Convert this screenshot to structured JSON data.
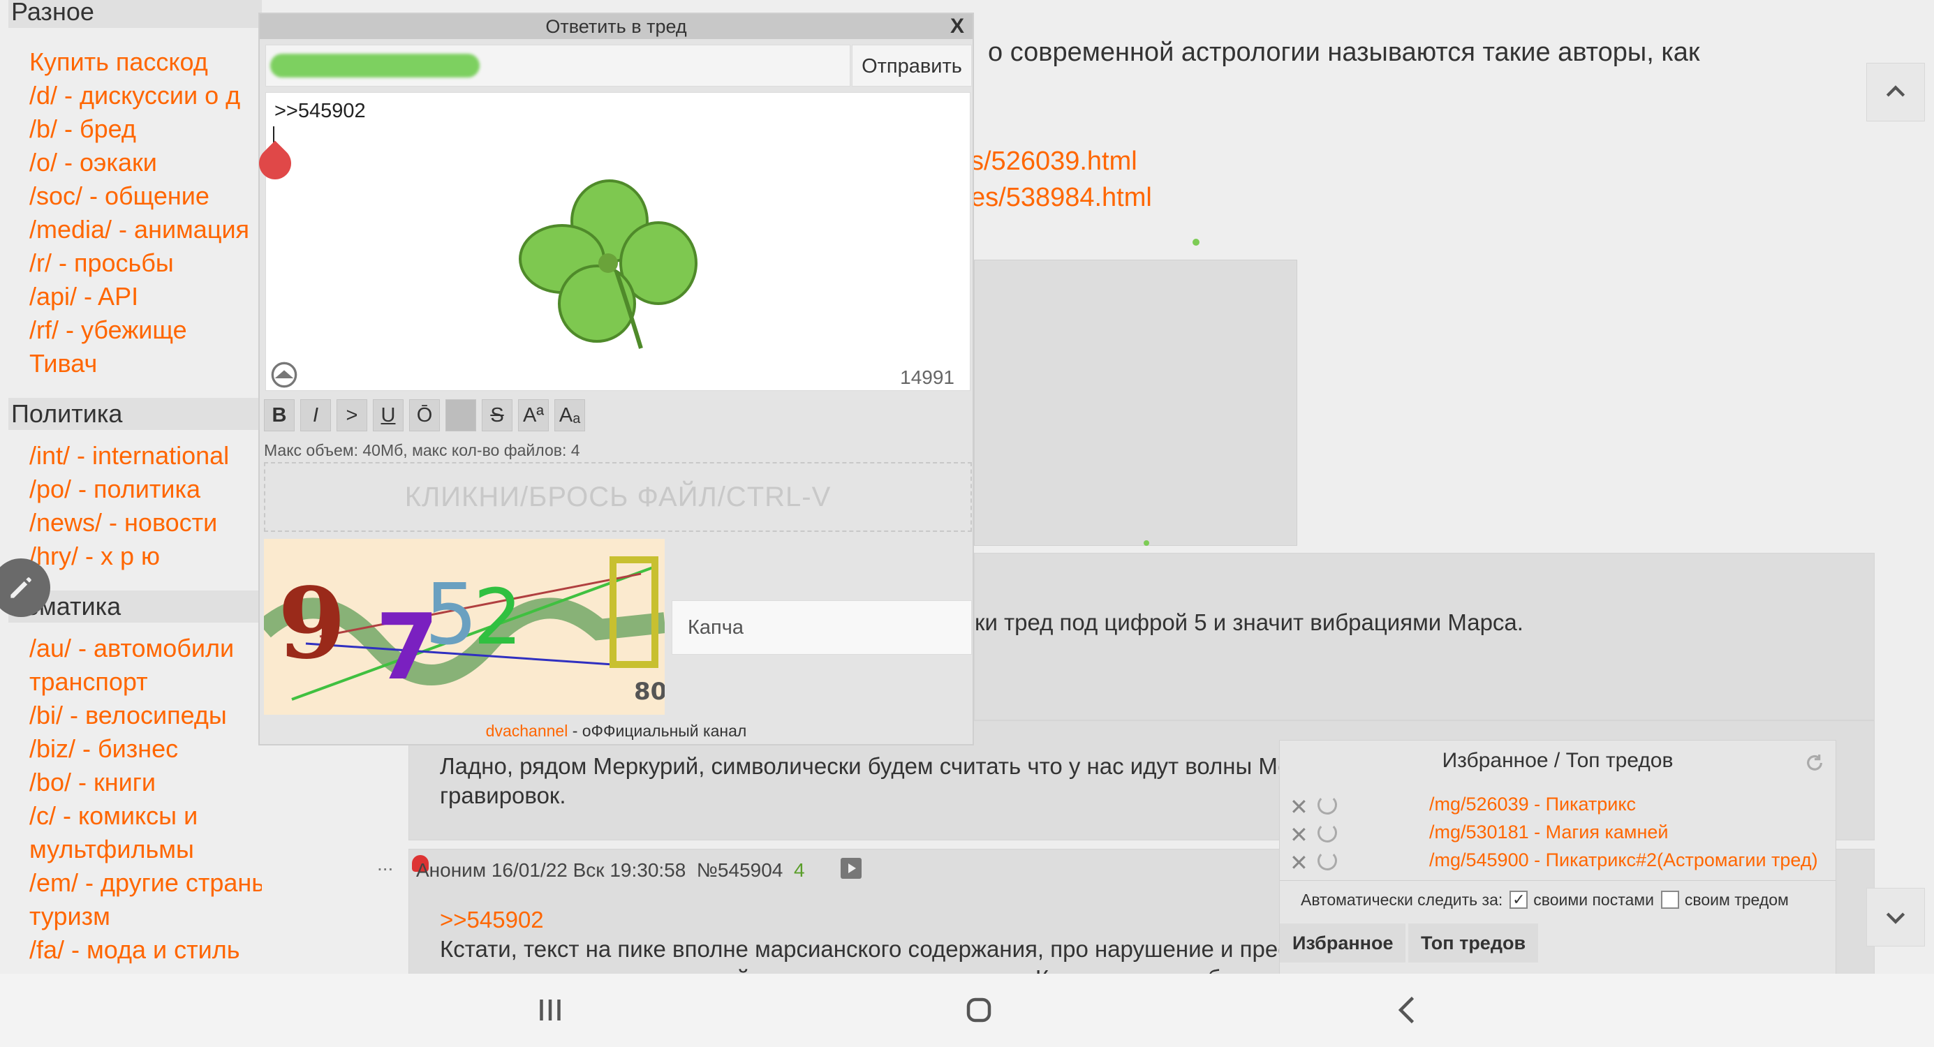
{
  "sidebar": {
    "sections": [
      {
        "title": "Разное",
        "items": [
          "Купить пасскод",
          "/d/ - дискуссии о д",
          "/b/ - бред",
          "/o/ - оэкаки",
          "/soc/ - общение",
          "/media/ - анимация",
          "/r/ - просьбы",
          "/api/ - API",
          "/rf/ - убежище",
          "Тивач"
        ]
      },
      {
        "title": "Политика",
        "items": [
          "/int/ - international",
          "/po/ - политика",
          "/news/ - новости",
          "/hry/ - х р ю"
        ]
      },
      {
        "title": "Тематика",
        "items": [
          "/au/ - автомобили",
          "транспорт",
          "/bi/ - велосипеды",
          "/biz/ - бизнес",
          "/bo/ - книги",
          "/c/ - комиксы и",
          "мультфильмы",
          "/em/ - другие страны и",
          "туризм",
          "/fa/ - мода и стиль"
        ]
      }
    ]
  },
  "thread": {
    "op_text": "о современной астрологии называются такие авторы, как",
    "op_links": [
      "s/526039.html",
      "es/538984.html"
    ],
    "post1_text": "ки тред под цифрой 5 и значит вибрациями Марса.",
    "post2_lines": [
      "Ладно, рядом Меркурий, символически будем считать что у нас идут волны Мер",
      "гравировок."
    ],
    "post3_meta": {
      "author": "Аноним",
      "date": "16/01/22 Вск 19:30:58",
      "num": "№545904",
      "replies": "4"
    },
    "post3_reply": ">>545902",
    "post3_lines": [
      "Кстати, текст на пике вполне марсианского содержания, про нарушение и преод",
      "естественная, а вот он какой перевод слова талисман. Кстати неплохо бы попул"
    ],
    "ellipsis": "..."
  },
  "reply_form": {
    "title": "Ответить в тред",
    "close": "X",
    "send_label": "Отправить",
    "message": ">>545902",
    "counter": "14991",
    "toolbar": [
      "B",
      "I",
      ">",
      "U",
      "Ō",
      "",
      "S",
      "Aª",
      "Aₐ"
    ],
    "limits": "Макс объем: 40Мб, макс кол-во файлов: 4",
    "drop_label": "КЛИКНИ/БРОСЬ ФАЙЛ/CTRL-V",
    "captcha_placeholder": "Капча",
    "captcha_digits": "80",
    "footer_channel": "dvachannel",
    "footer_rest": " - оФФициальный канал"
  },
  "favorites": {
    "title": "Избранное / Топ тредов",
    "items": [
      "/mg/526039 - Пикатрикс",
      "/mg/530181 - Магия камней",
      "/mg/545900 - Пикатрикс#2(Астромагии тред)"
    ],
    "auto_label": "Автоматически следить за:",
    "own_posts": "своими постами",
    "own_thread": "своим тредом",
    "tab_fav": "Избранное",
    "tab_top": "Топ тредов"
  },
  "colors": {
    "link": "#ff6600",
    "bg": "#eeeeee",
    "panel": "#dddddd"
  }
}
